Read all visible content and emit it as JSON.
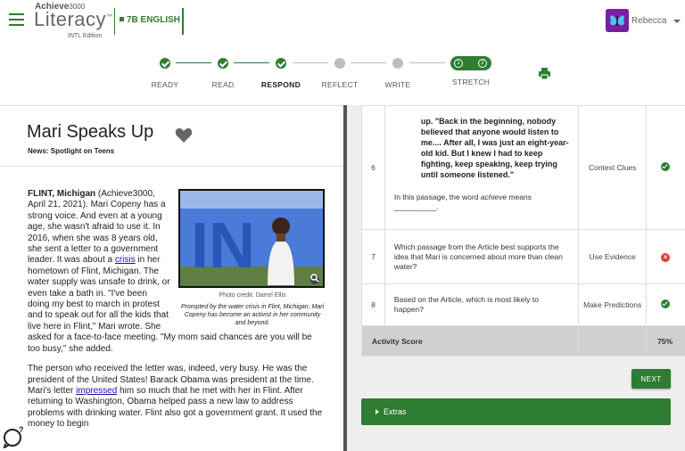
{
  "header": {
    "brand_top": "Achieve",
    "brand_top_num": "3000",
    "brand_main": "Literacy",
    "brand_tm": "™",
    "edition": "INTL Edition",
    "class_name": "7B ENGLISH",
    "user_name": "Rebecca"
  },
  "stepper": {
    "steps": [
      {
        "label": "READY",
        "state": "done"
      },
      {
        "label": "READ",
        "state": "done"
      },
      {
        "label": "RESPOND",
        "state": "current"
      },
      {
        "label": "REFLECT",
        "state": "todo"
      },
      {
        "label": "WRITE",
        "state": "todo"
      },
      {
        "label": "STRETCH",
        "state": "stretch"
      }
    ],
    "stretch_items": [
      "1",
      "2"
    ]
  },
  "article": {
    "title": "Mari Speaks Up",
    "subtitle": "News: Spotlight on Teens",
    "dateline": "FLINT, Michigan",
    "p1_a": " (Achieve3000, April 21, 2021). Mari Copeny has a strong voice. And even at a young age, she wasn't afraid to use it. In 2016, when she was 8 years old, she sent a letter to a government leader. It was about a ",
    "p1_link": "crisis",
    "p1_b": " in her hometown of Flint, Michigan. The water supply was unsafe to drink, or even take a bath in. \"I've been doing my best to march in protest and to speak out for all the kids that live here in Flint,\" Mari wrote. She asked for a face-to-face meeting. \"My mom said chances are you will be too busy,\" she added.",
    "p2_a": "The person who received the letter was, indeed, very busy. He was the president of the United States! Barack Obama was president at the time. Mari's letter ",
    "p2_link": "impressed",
    "p2_b": " him so much that he met with her in Flint. After returning to Washington, Obama helped pass a new law to address problems with drinking water. Flint also got a government grant. It used the money to begin",
    "photo_credit": "Photo credit: Darrel Ellis",
    "photo_caption": "Prompted by the water crisis in Flint, Michigan, Mari Copeny has become an activist in her community and beyond.",
    "photo_letters": "IN"
  },
  "questions": {
    "rows": [
      {
        "num": "6",
        "quote": "up. \"Back in the beginning, nobody believed that anyone would listen to me.... After all, I was just an eight-year-old kid. But I knew I had to keep fighting, keep speaking, keep trying until someone listened.\"",
        "prompt_a": "In this passage, the word ",
        "prompt_em": "achieve",
        "prompt_b": " means",
        "blank": "__________.",
        "skill": "Context Clues",
        "result": "correct"
      },
      {
        "num": "7",
        "prompt": "Which passage from the Article best supports the idea that Mari is concerned about more than clean water?",
        "skill": "Use Evidence",
        "result": "incorrect"
      },
      {
        "num": "8",
        "prompt": "Based on the Article, which is most likely to happen?",
        "skill": "Make Predictions",
        "result": "correct"
      }
    ],
    "score_label": "Activity Score",
    "score_value": "75%"
  },
  "buttons": {
    "next": "NEXT",
    "extras": "Extras"
  },
  "colors": {
    "accent": "#2e7d32",
    "incorrect": "#e53935",
    "avatar": "#8e24aa"
  }
}
